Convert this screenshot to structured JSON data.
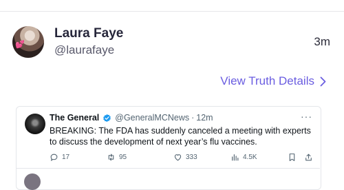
{
  "post": {
    "author_name": "Laura Faye",
    "author_handle": "@laurafaye",
    "time_ago": "3m",
    "avatar_glyph": "💕",
    "details_link": "View Truth Details"
  },
  "embedded_tweet": {
    "name": "The General",
    "handle": "@GeneralMCNews",
    "separator": "·",
    "time": "12m",
    "text": "BREAKING: The FDA  has suddenly canceled a meeting with experts to discuss the development of next year’s flu vaccines.",
    "more": "···",
    "reply_count": "17",
    "retweet_count": "95",
    "like_count": "333",
    "view_count": "4.5K"
  },
  "colors": {
    "link": "#6a5de0",
    "verified": "#1d9bf0"
  },
  "icons": [
    "chevron-right-icon",
    "verified-badge-icon",
    "reply-icon",
    "retweet-icon",
    "like-icon",
    "views-icon",
    "bookmark-icon",
    "share-icon"
  ]
}
